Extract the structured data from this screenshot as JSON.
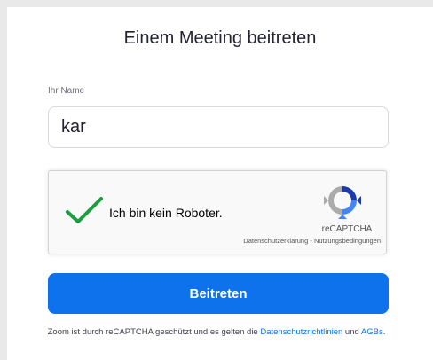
{
  "page": {
    "title": "Einem Meeting beitreten"
  },
  "name_field": {
    "label": "Ihr Name",
    "value": "kar"
  },
  "recaptcha": {
    "checkbox_label": "Ich bin kein Roboter.",
    "checked": true,
    "brand": "reCAPTCHA",
    "privacy_link": "Datenschutzerklärung",
    "separator": " - ",
    "terms_link": "Nutzungsbedingungen",
    "check_color": "#1a9e3f"
  },
  "join_button": {
    "label": "Beitreten",
    "color": "#0e72ed"
  },
  "footer": {
    "text_before": "Zoom ist durch reCAPTCHA geschützt und es gelten die ",
    "privacy_link": "Datenschutzrichtlinien",
    "text_middle": " und ",
    "terms_link": "AGBs",
    "text_after": "."
  }
}
